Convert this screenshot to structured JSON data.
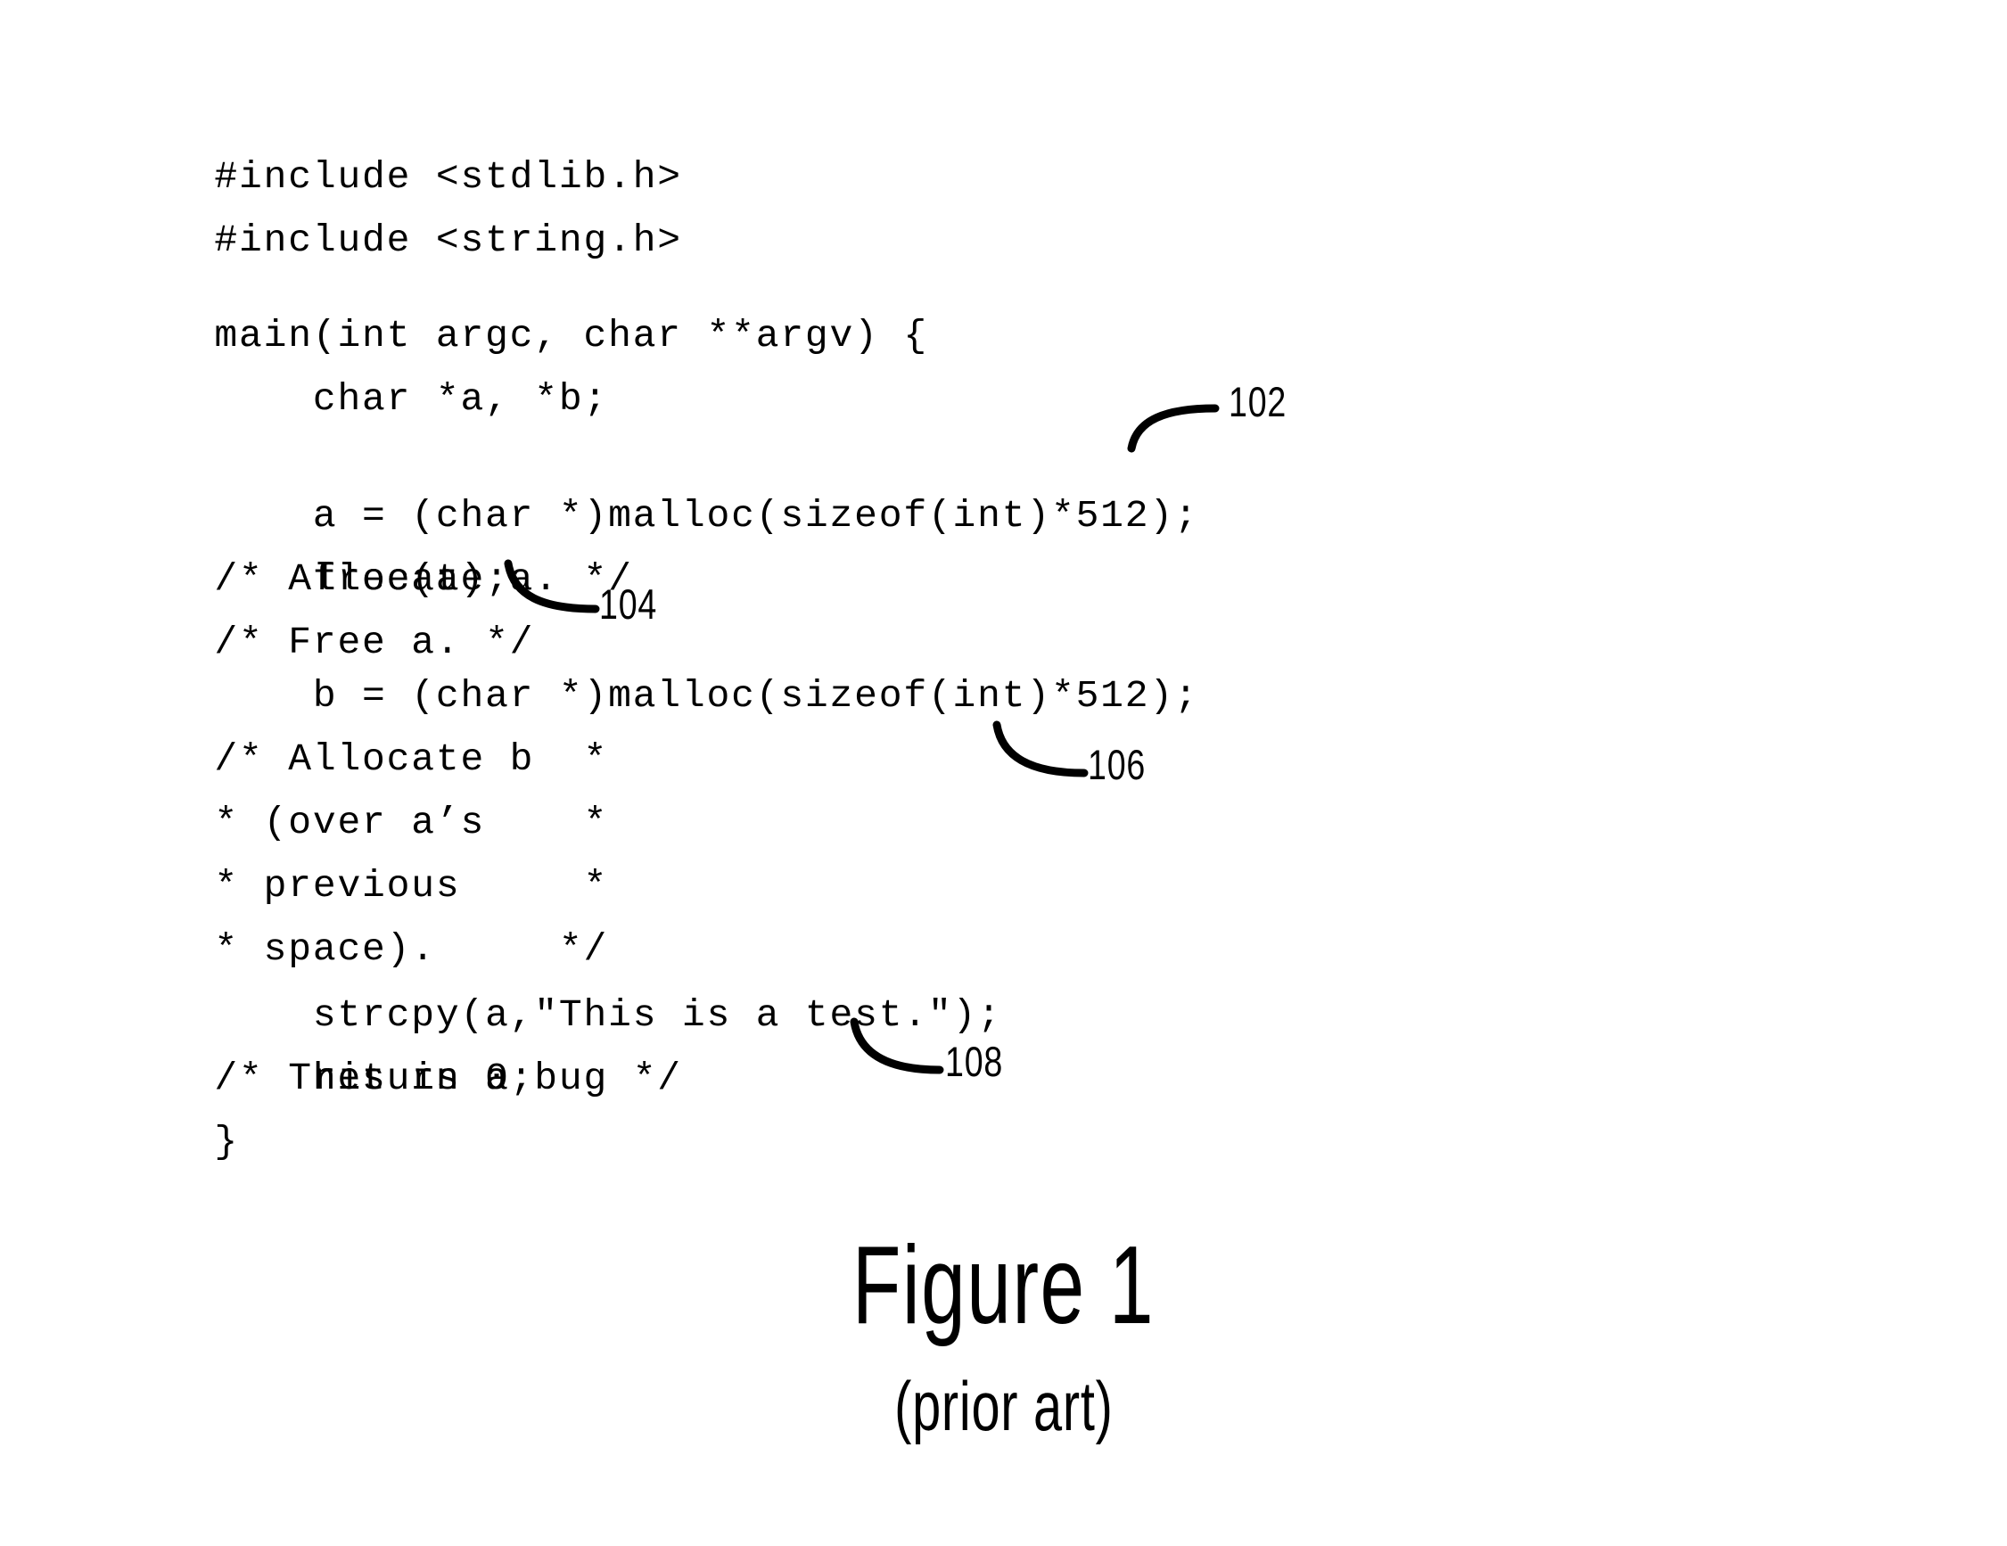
{
  "figure": {
    "title": "Figure 1",
    "subtitle": "(prior art)"
  },
  "code": {
    "language": "C",
    "lines": [
      {
        "id": "line-include-stdlib",
        "code": "#include <stdlib.h>",
        "comment": ""
      },
      {
        "id": "line-include-string",
        "code": "#include <string.h>",
        "comment": ""
      },
      {
        "id": "line-blank-1",
        "code": "",
        "comment": ""
      },
      {
        "id": "line-main-signature",
        "code": "main(int argc, char **argv) {",
        "comment": ""
      },
      {
        "id": "line-declare-a-b",
        "code": "    char *a, *b;",
        "comment": ""
      },
      {
        "id": "line-blank-2",
        "code": "",
        "comment": ""
      },
      {
        "id": "line-alloc-a",
        "code": "    a = (char *)malloc(sizeof(int)*512);",
        "comment": "/* Allocate a. */"
      },
      {
        "id": "line-free-a",
        "code": "    free(a);",
        "comment": "/* Free a. */"
      },
      {
        "id": "line-blank-3",
        "code": "",
        "comment": ""
      },
      {
        "id": "line-alloc-b",
        "code": "    b = (char *)malloc(sizeof(int)*512);",
        "comment": "/* Allocate b  *"
      },
      {
        "id": "line-comment-over-as",
        "code": "",
        "comment": "* (over a’s    *"
      },
      {
        "id": "line-comment-previous",
        "code": "",
        "comment": "* previous     *"
      },
      {
        "id": "line-comment-space",
        "code": "",
        "comment": "* space).     */"
      },
      {
        "id": "line-blank-4",
        "code": "",
        "comment": ""
      },
      {
        "id": "line-strcpy",
        "code": "    strcpy(a,\"This is a test.\");",
        "comment": "/* This is a bug */"
      },
      {
        "id": "line-return",
        "code": "    return 0;",
        "comment": ""
      },
      {
        "id": "line-close-brace",
        "code": "}",
        "comment": ""
      }
    ]
  },
  "callouts": [
    {
      "id": "callout-102",
      "label": "102",
      "refers_to": "malloc allocation of a"
    },
    {
      "id": "callout-104",
      "label": "104",
      "refers_to": "free(a) call"
    },
    {
      "id": "callout-106",
      "label": "106",
      "refers_to": "malloc allocation of b"
    },
    {
      "id": "callout-108",
      "label": "108",
      "refers_to": "strcpy into freed buffer a"
    }
  ],
  "colors": {
    "ink": "#000000",
    "background": "#ffffff"
  }
}
